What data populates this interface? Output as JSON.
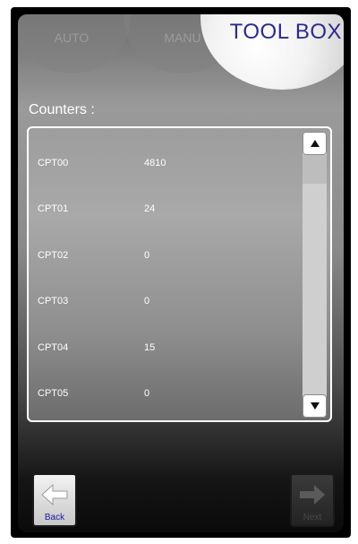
{
  "tabs": [
    {
      "label": "AUTO"
    },
    {
      "label": "MANU"
    }
  ],
  "toolbox": {
    "title": "TOOL BOX"
  },
  "counters": {
    "label": "Counters :",
    "rows": [
      {
        "name": "CPT00",
        "value": "4810"
      },
      {
        "name": "CPT01",
        "value": "24"
      },
      {
        "name": "CPT02",
        "value": "0"
      },
      {
        "name": "CPT03",
        "value": "0"
      },
      {
        "name": "CPT04",
        "value": "15"
      },
      {
        "name": "CPT05",
        "value": "0"
      }
    ]
  },
  "scroll": {
    "up_icon": "triangle-up-icon",
    "down_icon": "triangle-down-icon"
  },
  "nav": {
    "back": {
      "label": "Back",
      "icon": "arrow-left-icon"
    },
    "next": {
      "label": "Next",
      "icon": "arrow-right-icon"
    }
  },
  "colors": {
    "title": "#2b2b8a",
    "back_label": "#1a1aa0"
  }
}
